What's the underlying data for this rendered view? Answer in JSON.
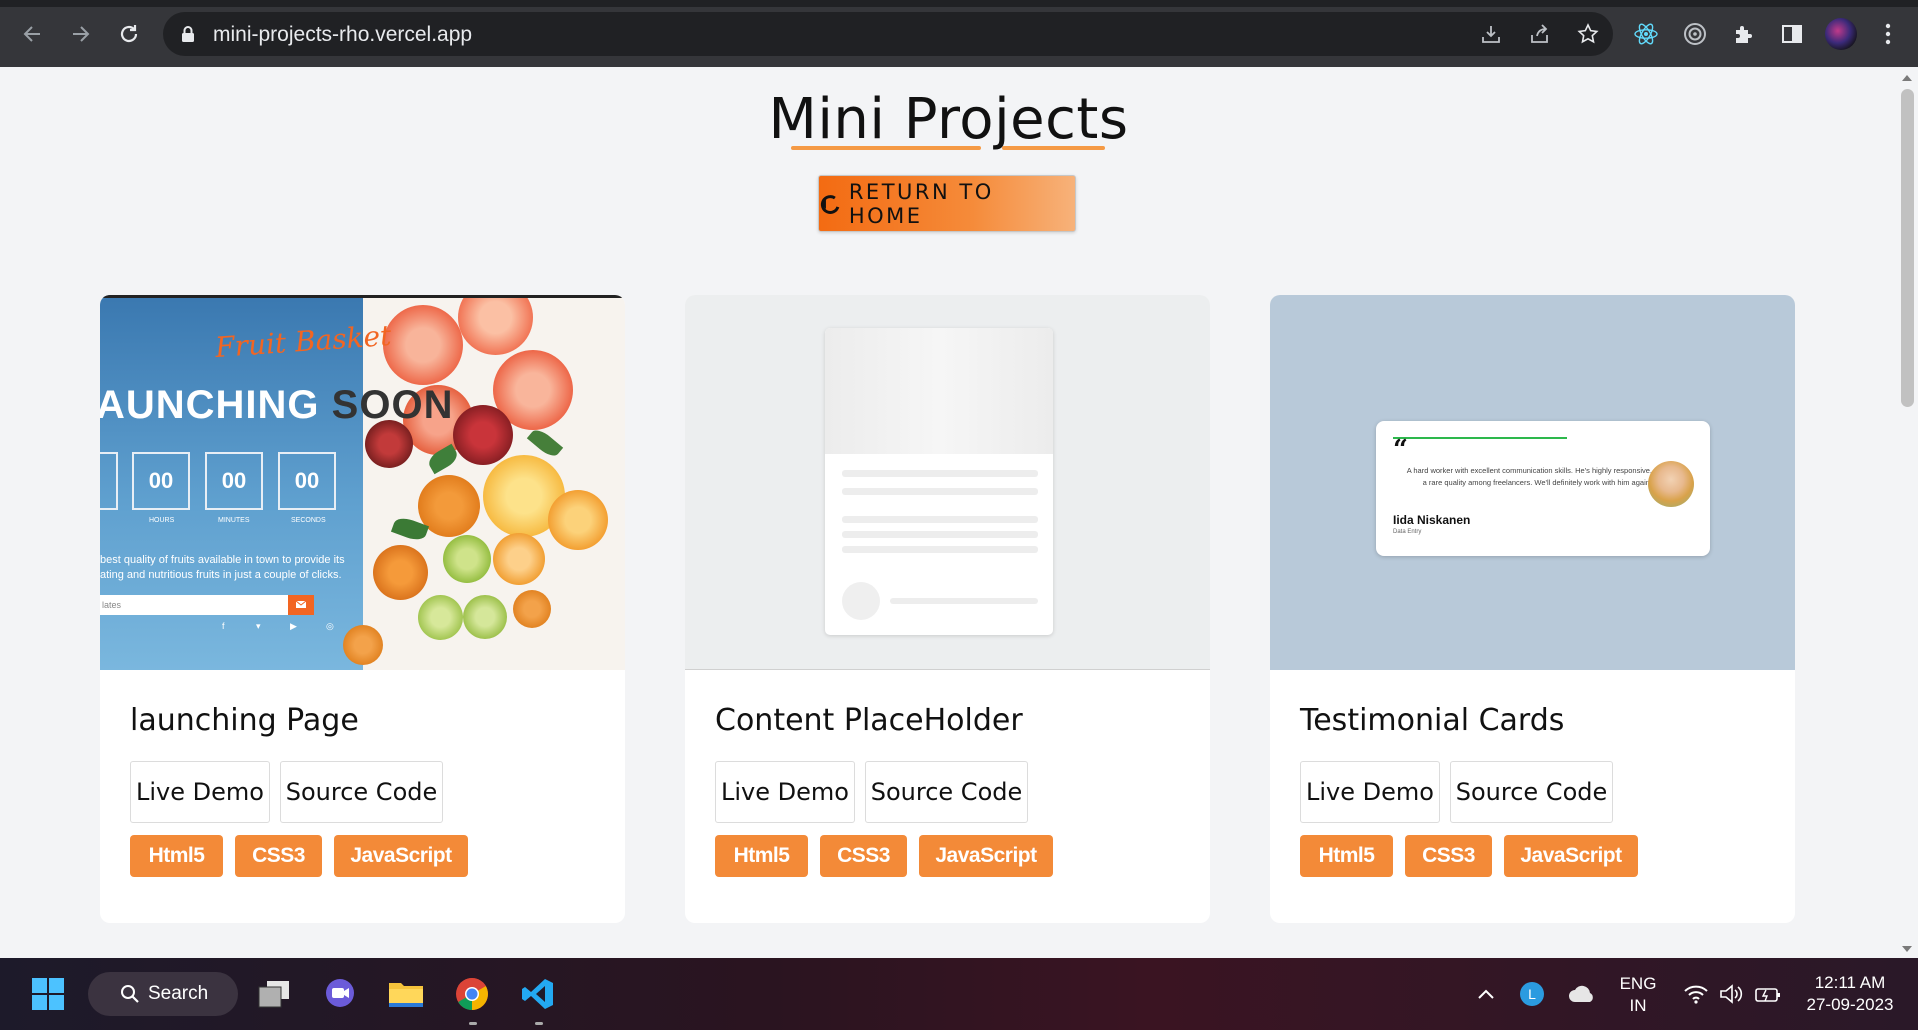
{
  "browser": {
    "url": "mini-projects-rho.vercel.app",
    "back_icon": "arrow-left",
    "forward_icon": "arrow-right",
    "reload_icon": "reload"
  },
  "page": {
    "title": "Mini Projects",
    "home_button": "RETURN TO HOME",
    "accent_color": "#f38a38"
  },
  "cards": [
    {
      "title": "launching Page",
      "live_demo": "Live Demo",
      "source_code": "Source Code",
      "tags": [
        "Html5",
        "CSS3",
        "JavaScript"
      ],
      "preview": {
        "brand": "Fruit Basket",
        "heading_light": "AUNCHING ",
        "heading_dark": "SOON",
        "counters": [
          "00",
          "00",
          "00"
        ],
        "counter_labels": [
          "HOURS",
          "MINUTES",
          "SECONDS"
        ],
        "desc_line1": "best quality of fruits available in town to provide its",
        "desc_line2": "ating and nutritious fruits in just a couple of clicks.",
        "input_placeholder": "lates"
      }
    },
    {
      "title": "Content PlaceHolder",
      "live_demo": "Live Demo",
      "source_code": "Source Code",
      "tags": [
        "Html5",
        "CSS3",
        "JavaScript"
      ]
    },
    {
      "title": "Testimonial Cards",
      "live_demo": "Live Demo",
      "source_code": "Source Code",
      "tags": [
        "Html5",
        "CSS3",
        "JavaScript"
      ],
      "preview": {
        "quote": "A hard worker with excellent communication skills. He's highly responsive, a rare quality among freelancers. We'll definitely work with him again.",
        "name": "Iida Niskanen",
        "role": "Data Entry"
      }
    }
  ],
  "taskbar": {
    "search_label": "Search",
    "language_line1": "ENG",
    "language_line2": "IN",
    "time": "12:11 AM",
    "date": "27-09-2023"
  }
}
